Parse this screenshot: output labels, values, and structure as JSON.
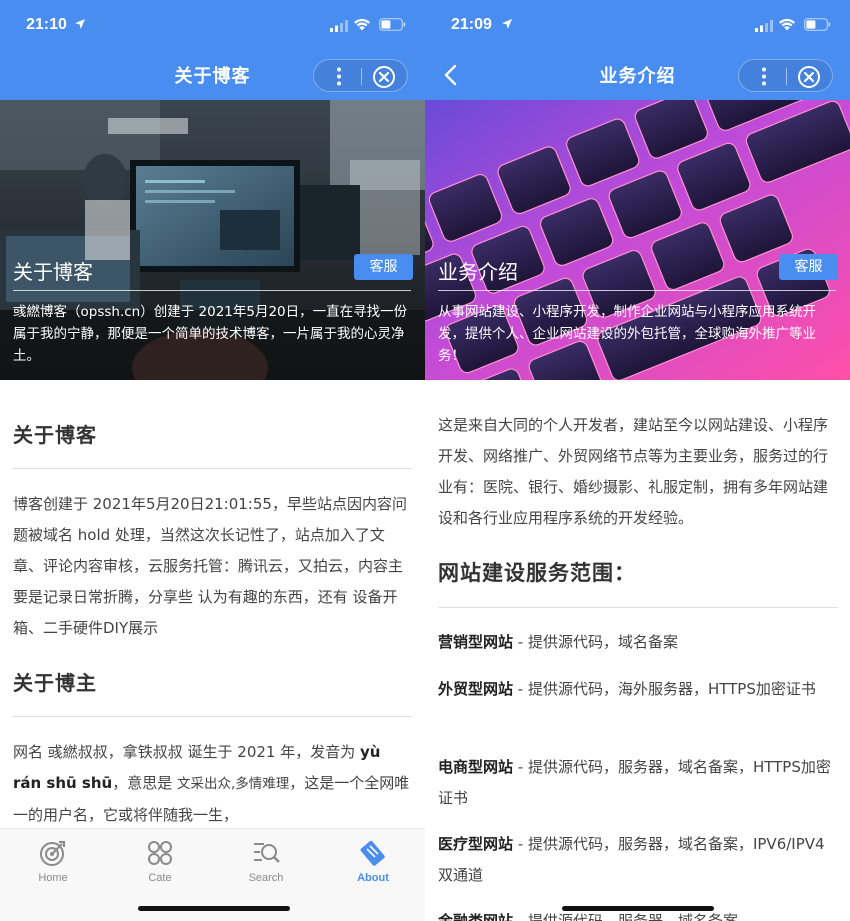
{
  "left": {
    "status": {
      "time": "21:10"
    },
    "nav_title": "关于博客",
    "hero": {
      "title": "关于博客",
      "service_button": "客服",
      "description": "彧繎博客（opssh.cn）创建于 2021年5月20日，一直在寻找一份属于我的宁静，那便是一个简单的技术博客，一片属于我的心灵净土。"
    },
    "section1": {
      "heading": "关于博客",
      "text": "博客创建于 2021年5月20日21:01:55，早些站点因内容问题被域名 hold 处理，当然这次长记性了，站点加入了文章、评论内容审核，云服务托管：腾讯云，又拍云，内容主要是记录日常折腾，分享些 认为有趣的东西，还有 设备开箱、二手硬件DIY展示"
    },
    "section2": {
      "heading": "关于博主",
      "text_a": "网名 彧繎叔叔，拿铁叔叔 诞生于 2021 年，发音为 ",
      "pinyin": "yù rán shū shū",
      "text_b": "，意思是 ",
      "meaning": "文采出众,多情难理",
      "text_c": "，这是一个全网唯一的用户名，它或将伴随我一生，"
    },
    "tabbar": {
      "items": [
        {
          "label": "Home",
          "icon": "target-icon"
        },
        {
          "label": "Cate",
          "icon": "category-icon"
        },
        {
          "label": "Search",
          "icon": "search-icon"
        },
        {
          "label": "About",
          "icon": "about-icon"
        }
      ],
      "active": "About"
    }
  },
  "right": {
    "status": {
      "time": "21:09"
    },
    "nav_title": "业务介绍",
    "hero": {
      "title": "业务介绍",
      "service_button": "客服",
      "description": "从事网站建设、小程序开发，制作企业网站与小程序应用系统开发，提供个人、企业网站建设的外包托管，全球购海外推广等业务！"
    },
    "intro": "这是来自大同的个人开发者，建站至今以网站建设、小程序开发、网络推广、外贸网络节点等为主要业务，服务过的行业有：医院、银行、婚纱摄影、礼服定制，拥有多年网站建设和各行业应用程序系统的开发经验。",
    "services_heading": "网站建设服务范围：",
    "services": [
      {
        "name": "营销型网站",
        "desc": " - 提供源代码，域名备案"
      },
      {
        "name": "外贸型网站",
        "desc": " - 提供源代码，海外服务器，HTTPS加密证书"
      },
      {
        "name": "电商型网站",
        "desc": " - 提供源代码，服务器，域名备案，HTTPS加密证书"
      },
      {
        "name": "医疗型网站",
        "desc": " - 提供源代码，服务器，域名备案，IPV6/IPV4双通道"
      },
      {
        "name": "金融类网站",
        "desc": " - 提供源代码，服务器，域名备案"
      }
    ]
  },
  "colors": {
    "accent": "#4a8df0"
  }
}
